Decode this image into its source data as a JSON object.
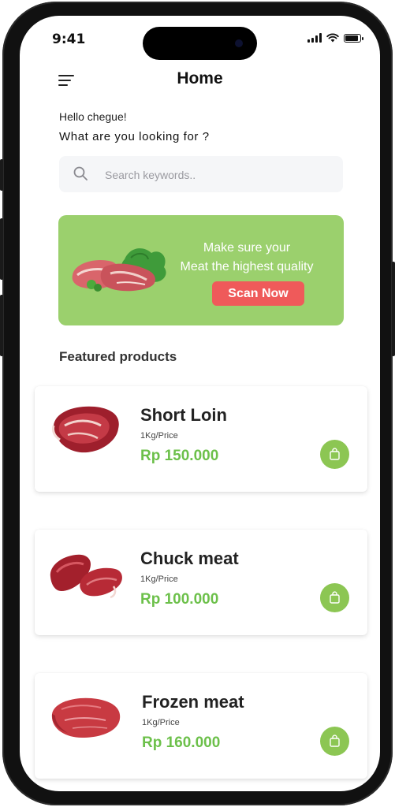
{
  "status_bar": {
    "time": "9:41"
  },
  "header": {
    "title": "Home",
    "menu_icon": "menu-icon"
  },
  "greeting": {
    "hello": "Hello chegue!",
    "question": "What are you looking for ?"
  },
  "search": {
    "placeholder": "Search keywords..",
    "value": "",
    "icon": "search-icon"
  },
  "banner": {
    "line1": "Make sure your",
    "line2": "Meat the highest quality",
    "button_label": "Scan Now",
    "background_color": "#9bd06d",
    "button_color": "#ef5a5a"
  },
  "featured": {
    "title": "Featured products",
    "products": [
      {
        "name": "Short Loin",
        "unit": "1Kg/Price",
        "price": "Rp 150.000"
      },
      {
        "name": "Chuck meat",
        "unit": "1Kg/Price",
        "price": "Rp 100.000"
      },
      {
        "name": "Frozen meat",
        "unit": "1Kg/Price",
        "price": "Rp 160.000"
      }
    ],
    "price_color": "#6cc04a",
    "cart_icon": "shopping-bag-icon"
  }
}
